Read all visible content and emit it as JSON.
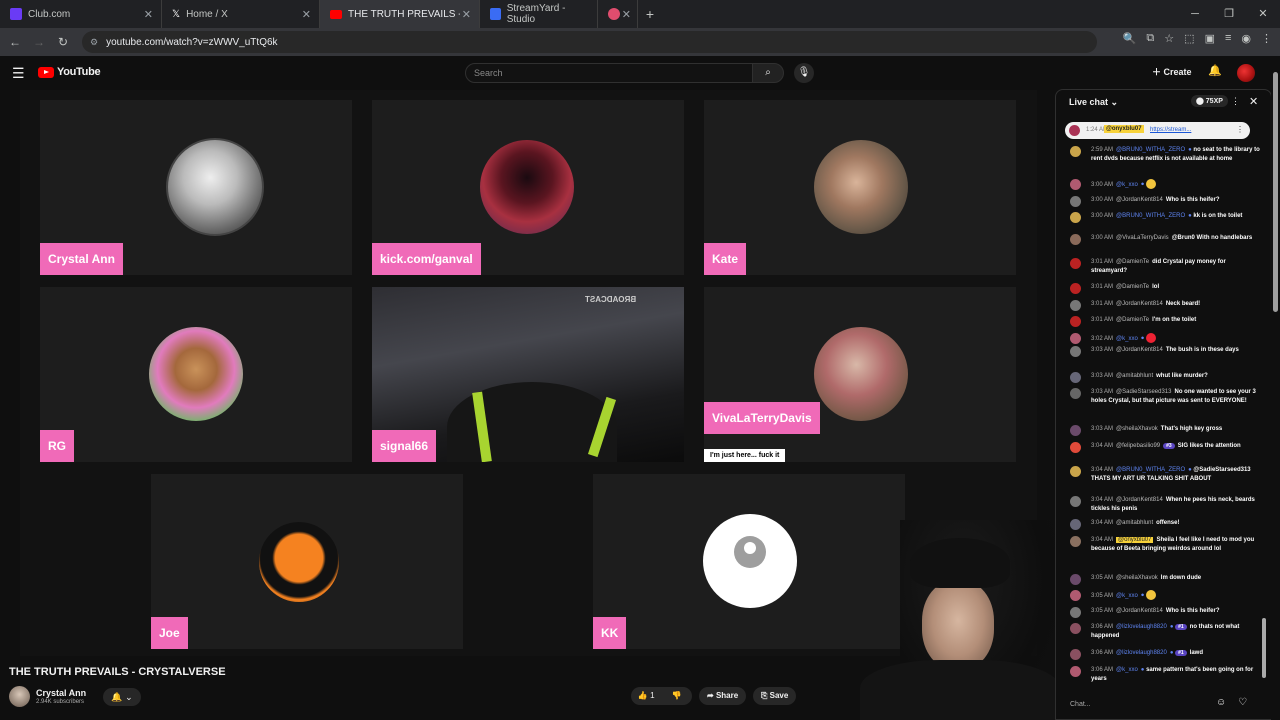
{
  "browser": {
    "tabs": [
      {
        "title": "Club.com",
        "color": "#6a3bf5"
      },
      {
        "title": "Home / X",
        "color": "#000000"
      },
      {
        "title": "THE TRUTH PREVAILS - CRYSTA",
        "color": "#ff0000"
      },
      {
        "title": "StreamYard - Studio",
        "color": "#3a6cf4"
      },
      {
        "title": "",
        "color": "#e04d6e"
      }
    ],
    "url": "youtube.com/watch?v=zWWV_uTtQ6k"
  },
  "youtube": {
    "logo": "YouTube",
    "search_placeholder": "Search",
    "create_label": "Create"
  },
  "video": {
    "participants": [
      {
        "name": "Crystal Ann"
      },
      {
        "name": "kick.com/ganval"
      },
      {
        "name": "Kate"
      },
      {
        "name": "RG"
      },
      {
        "name": "signal66"
      },
      {
        "name": "VivaLaTerryDavis",
        "caption": "I'm just here... fuck it"
      },
      {
        "name": "Joe"
      },
      {
        "name": "KK"
      }
    ],
    "stream_watermark": "BROADCAST"
  },
  "info": {
    "title": "THE TRUTH PREVAILS - CRYSTALVERSE",
    "channel": "Crystal Ann",
    "subscribers": "2.94K subscribers",
    "likes": "1",
    "share_label": "Share",
    "save_label": "Save"
  },
  "chat": {
    "header": "Live chat",
    "xp": "75XP",
    "pinned": {
      "time": "1:24 AM",
      "user": "@onyxblu07",
      "link": "https://stream..."
    },
    "input_placeholder": "Chat...",
    "messages": [
      {
        "time": "2:59 AM",
        "user": "@BRUN0_WITHA_ZERO",
        "text": "no seat to the library to rent dvds because netflix is not available at home",
        "mod": true
      },
      {
        "time": "3:00 AM",
        "user": "@k_xxo",
        "text": "",
        "mod": true
      },
      {
        "time": "3:00 AM",
        "user": "@JordanKent814",
        "text": "Who is this heifer?"
      },
      {
        "time": "3:00 AM",
        "user": "@BRUN0_WITHA_ZERO",
        "text": "kk is on the toilet",
        "mod": true
      },
      {
        "time": "3:00 AM",
        "user": "@VivaLaTerryDavis",
        "text": "@Brun0 With no handlebars"
      },
      {
        "time": "3:01 AM",
        "user": "@DamienTe",
        "text": "did Crystal pay money for streamyard?"
      },
      {
        "time": "3:01 AM",
        "user": "@DamienTe",
        "text": "lol"
      },
      {
        "time": "3:01 AM",
        "user": "@JordanKent814",
        "text": "Neck beard!"
      },
      {
        "time": "3:01 AM",
        "user": "@DamienTe",
        "text": "I'm on the toilet"
      },
      {
        "time": "3:02 AM",
        "user": "@k_xxo",
        "text": "",
        "mod": true
      },
      {
        "time": "3:03 AM",
        "user": "@JordanKent814",
        "text": "The bush is in these days"
      },
      {
        "time": "3:03 AM",
        "user": "@amitabhlunt",
        "text": "whut like murder?"
      },
      {
        "time": "3:03 AM",
        "user": "@SadieStarseed313",
        "text": "No one wanted to see your 3 holes Crystal, but that picture was sent to EVERYONE!"
      },
      {
        "time": "3:03 AM",
        "user": "@sheilaXhavok",
        "text": "That's high key gross"
      },
      {
        "time": "3:04 AM",
        "user": "@felipebasilio99",
        "text": "SIG likes the attention",
        "badge": "#3"
      },
      {
        "time": "3:04 AM",
        "user": "@BRUN0_WITHA_ZERO",
        "text": "@SadieStarseed313 THATS MY ART UR TALKING SHIT ABOUT",
        "mod": true
      },
      {
        "time": "3:04 AM",
        "user": "@JordanKent814",
        "text": "When he pees his neck, beards tickles his penis"
      },
      {
        "time": "3:04 AM",
        "user": "@amitabhlunt",
        "text": "offense!"
      },
      {
        "time": "3:04 AM",
        "user": "@onyxblu07",
        "text": "Sheila I feel like I need to mod you because of Beeta bringing weirdos around lol",
        "highlight": true
      },
      {
        "time": "3:05 AM",
        "user": "@sheilaXhavok",
        "text": "Im down dude"
      },
      {
        "time": "3:05 AM",
        "user": "@k_xxo",
        "text": "",
        "mod": true
      },
      {
        "time": "3:05 AM",
        "user": "@JordanKent814",
        "text": "Who is this heifer?"
      },
      {
        "time": "3:06 AM",
        "user": "@lizlovelaugh8820",
        "text": "no thats not what happened",
        "mod": true,
        "badge": "#1"
      },
      {
        "time": "3:06 AM",
        "user": "@lizlovelaugh8820",
        "text": "lawd",
        "mod": true,
        "badge": "#1"
      },
      {
        "time": "3:06 AM",
        "user": "@k_xxo",
        "text": "same pattern that's been going on for years",
        "mod": true
      }
    ]
  }
}
